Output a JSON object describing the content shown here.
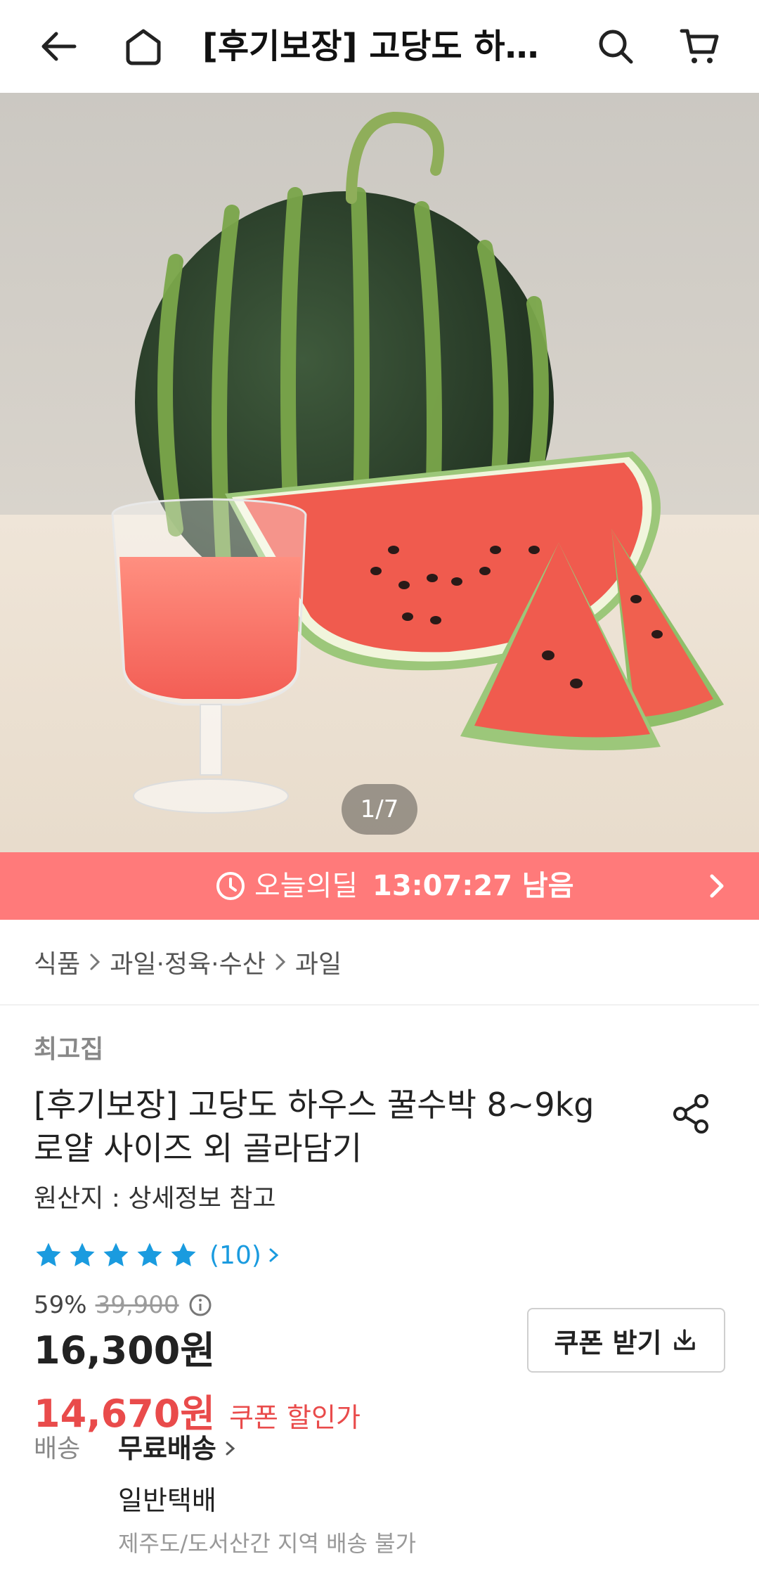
{
  "header": {
    "title": "[후기보장] 고당도 하우스 꿀수박 8~9kg 로얄 사이즈 외 골라담기",
    "icons": [
      "back-arrow-icon",
      "home-icon",
      "search-icon",
      "cart-icon"
    ]
  },
  "gallery": {
    "counter": "1/7",
    "current": 1,
    "total": 7
  },
  "deal": {
    "label": "오늘의딜",
    "time_left": "13:07:27 남음",
    "color": "#ff7a7a"
  },
  "breadcrumb": [
    "식품",
    "과일·정육·수산",
    "과일"
  ],
  "product": {
    "seller": "최고집",
    "title": "[후기보장] 고당도 하우스 꿀수박 8~9kg 로얄 사이즈 외 골라담기",
    "origin": "원산지 : 상세정보 참고",
    "rating_stars": 5,
    "review_count": "(10)",
    "discount_rate": "59%",
    "original_price": "39,900",
    "price": "16,300원",
    "coupon_button": "쿠폰 받기",
    "coupon_price": "14,670원",
    "coupon_price_label": "쿠폰 할인가"
  },
  "shipping": {
    "label": "배송",
    "value": "무료배송",
    "method": "일반택배",
    "note": "제주도/도서산간 지역 배송 불가"
  },
  "colors": {
    "accent_blue": "#1a9bdf",
    "sale_red": "#e94b4b"
  }
}
